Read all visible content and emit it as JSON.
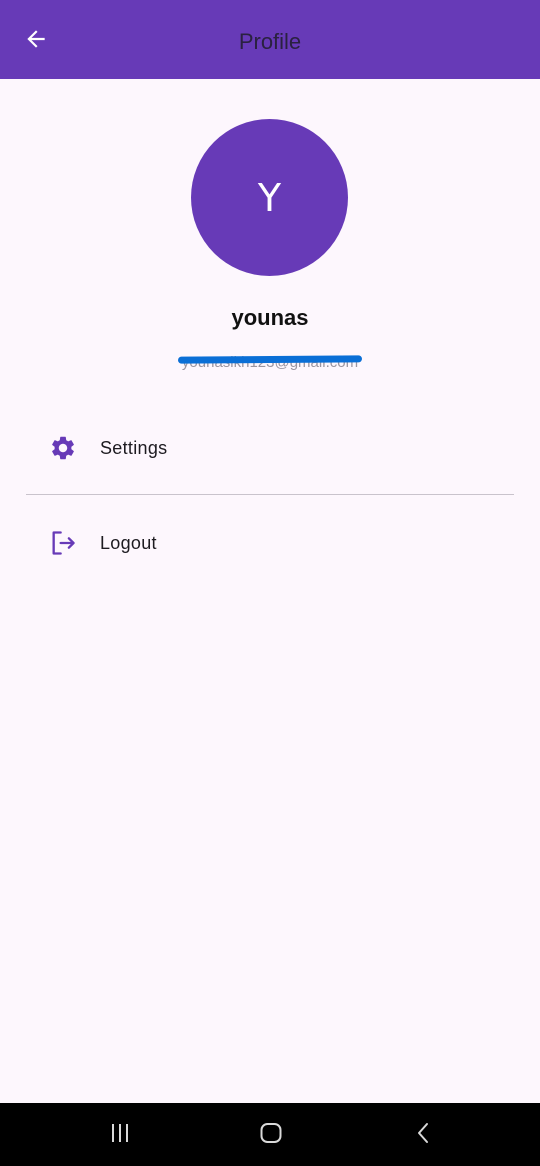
{
  "app_bar": {
    "title": "Profile",
    "back_icon": "arrow-back-icon",
    "background": "#673ab7"
  },
  "profile": {
    "avatar_letter": "Y",
    "name": "younas",
    "email": "younasikh123@gmail.com"
  },
  "menu": {
    "items": [
      {
        "label": "Settings",
        "icon": "gear-icon"
      },
      {
        "label": "Logout",
        "icon": "logout-icon"
      }
    ]
  },
  "system_nav": {
    "recent_icon": "recent-apps-icon",
    "home_icon": "home-icon",
    "back_icon": "chevron-left-icon"
  },
  "colors": {
    "accent": "#673ab7",
    "background": "#fdf7fd",
    "redaction": "#0a6fd6"
  }
}
